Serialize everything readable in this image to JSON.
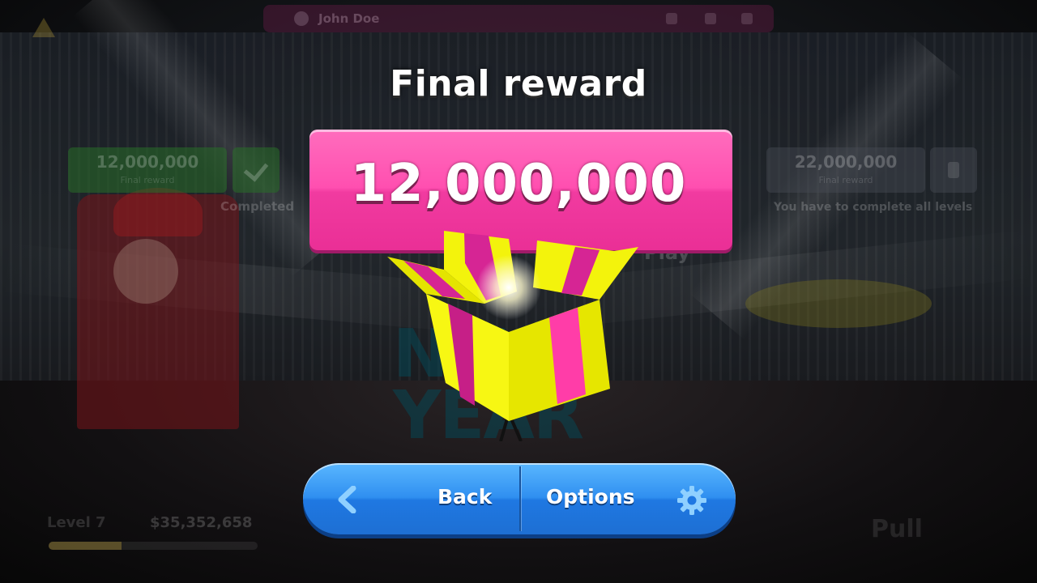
{
  "background": {
    "user_name": "John Doe",
    "left_card": {
      "amount": "12,000,000",
      "sub": "Final reward",
      "status": "Completed"
    },
    "right_card": {
      "amount": "22,000,000",
      "sub": "Final reward",
      "status": "You have to complete all levels"
    },
    "play_label": "Play",
    "banner_words": [
      "NEW",
      "YEAR"
    ],
    "level_label": "Level 7",
    "money": "$35,352,658",
    "pull_label": "Pull"
  },
  "title": "Final reward",
  "reward_amount": "12,000,000",
  "buttons": {
    "back_label": "Back",
    "options_label": "Options"
  },
  "icons": [
    "chevron-left-icon",
    "gear-icon",
    "user-icon",
    "warning-icon",
    "check-icon",
    "lock-icon",
    "gift-box-icon"
  ],
  "colors": {
    "reward_pink": "#ff4fb0",
    "button_blue": "#2f8ff0",
    "gift_yellow": "#f2f20a",
    "gift_ribbon": "#e0278f"
  }
}
